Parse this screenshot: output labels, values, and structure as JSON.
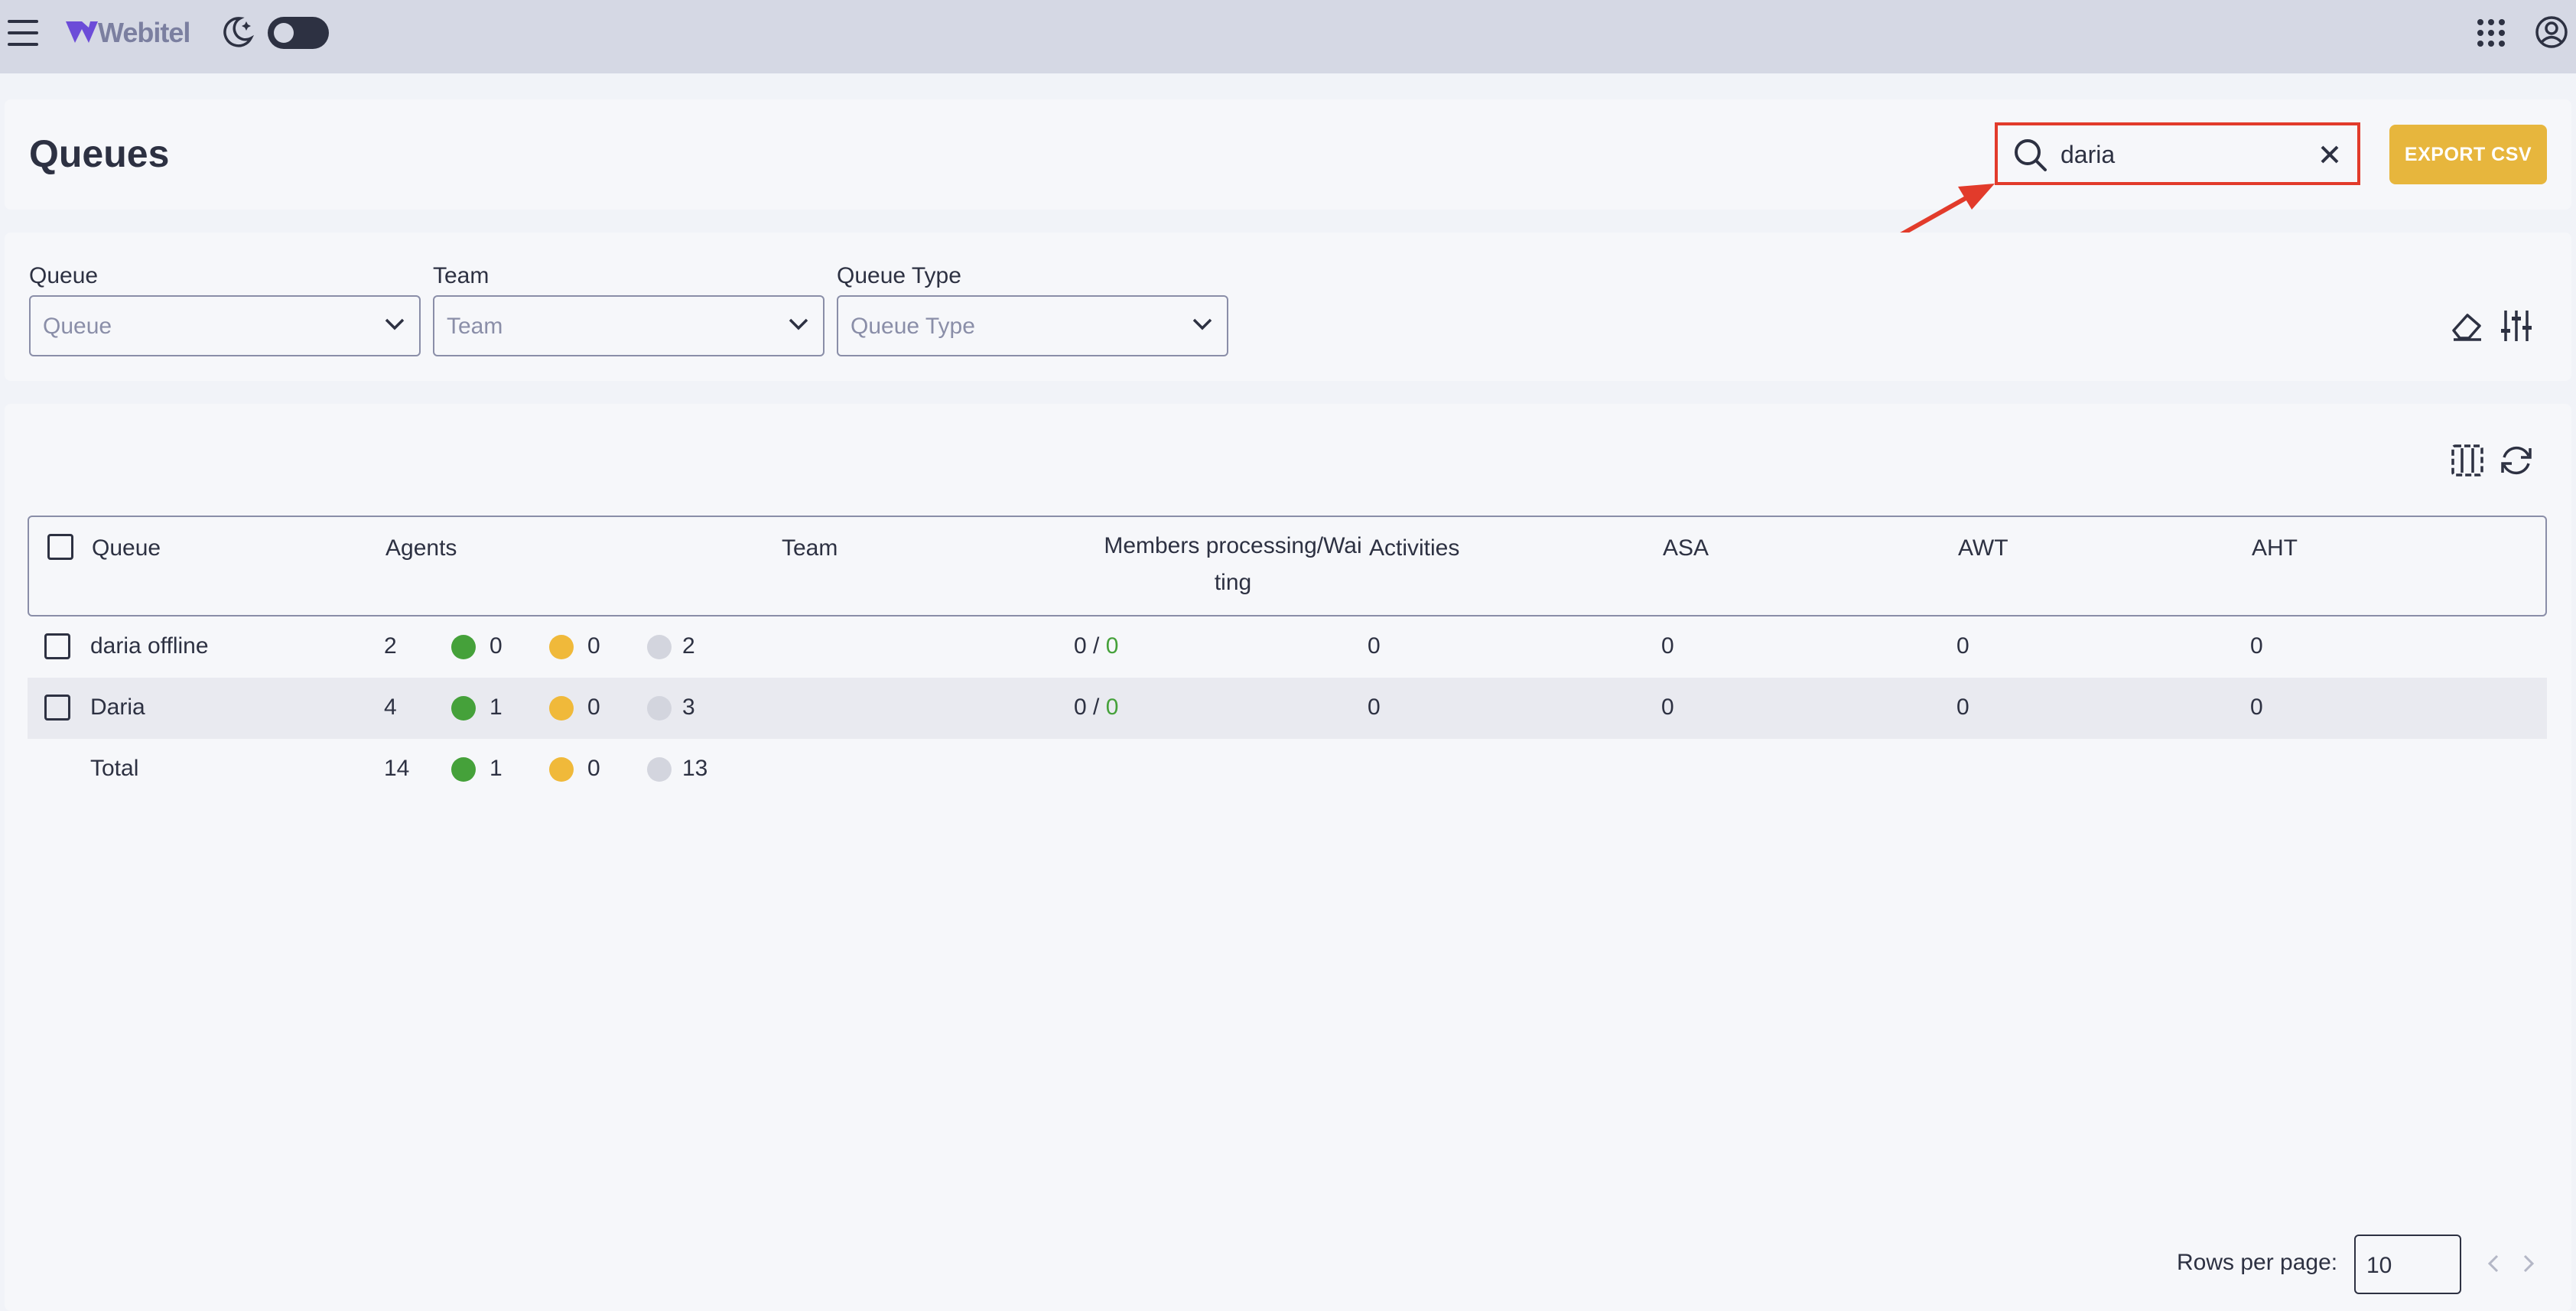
{
  "app": {
    "name": "Webitel"
  },
  "page": {
    "title": "Queues"
  },
  "search": {
    "value": "daria"
  },
  "toolbar": {
    "export_label": "EXPORT CSV"
  },
  "filters": [
    {
      "label": "Queue",
      "placeholder": "Queue"
    },
    {
      "label": "Team",
      "placeholder": "Team"
    },
    {
      "label": "Queue Type",
      "placeholder": "Queue Type"
    }
  ],
  "table": {
    "columns": {
      "queue": "Queue",
      "agents": "Agents",
      "team": "Team",
      "members_line1": "Members processing/Wai",
      "members_line2": "ting",
      "activities": "Activities",
      "asa": "ASA",
      "awt": "AWT",
      "aht": "AHT"
    },
    "rows": [
      {
        "queue": "daria offline",
        "agents": "2",
        "online": "0",
        "pause": "0",
        "offline": "2",
        "processing": "0",
        "sep": " / ",
        "waiting": "0",
        "activities": "0",
        "asa": "0",
        "awt": "0",
        "aht": "0"
      },
      {
        "queue": "Daria",
        "agents": "4",
        "online": "1",
        "pause": "0",
        "offline": "3",
        "processing": "0",
        "sep": " / ",
        "waiting": "0",
        "activities": "0",
        "asa": "0",
        "awt": "0",
        "aht": "0"
      }
    ],
    "total": {
      "label": "Total",
      "agents": "14",
      "online": "1",
      "pause": "0",
      "offline": "13"
    }
  },
  "pagination": {
    "rows_per_page_label": "Rows per page:",
    "rows_per_page": "10"
  },
  "colors": {
    "accent": "#e7b63d",
    "online": "#45a13a",
    "pause": "#f0b93a",
    "offline": "#d3d5de",
    "highlight": "#e23b2b"
  }
}
